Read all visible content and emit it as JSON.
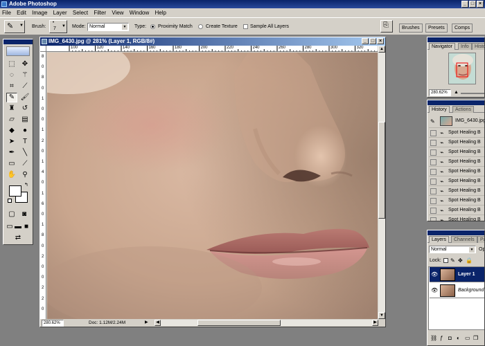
{
  "app": {
    "title": "Adobe Photoshop",
    "window_buttons": [
      "_",
      "□",
      "×"
    ]
  },
  "menubar": {
    "items": [
      "File",
      "Edit",
      "Image",
      "Layer",
      "Select",
      "Filter",
      "View",
      "Window",
      "Help"
    ]
  },
  "options": {
    "brush_label": "Brush:",
    "brush_size": "7",
    "mode_label": "Mode:",
    "mode_value": "Normal",
    "type_label": "Type:",
    "type_options": [
      "Proximity Match",
      "Create Texture"
    ],
    "type_selected": "Proximity Match",
    "sample_all_layers": "Sample All Layers",
    "sample_all_checked": false,
    "palette_well_tabs": [
      "Brushes",
      "Presets",
      "Comps"
    ]
  },
  "document": {
    "title": "IMG_6430.jpg @ 281% (Layer 1, RGB/8#)",
    "ruler_h": [
      "100",
      "120",
      "140",
      "160",
      "180",
      "200",
      "220",
      "240",
      "260",
      "280",
      "300",
      "320",
      "340"
    ],
    "ruler_v": [
      "8",
      "0",
      "8",
      "0",
      "1",
      "0",
      "0",
      "1",
      "2",
      "0",
      "1",
      "4",
      "0",
      "1",
      "6",
      "0",
      "1",
      "8",
      "0",
      "2",
      "0",
      "0",
      "2",
      "2",
      "0"
    ],
    "zoom": "280.62%",
    "doc_info": "Doc: 1.12M/2.24M"
  },
  "navigator": {
    "tabs": [
      "Navigator",
      "Info",
      "Histo"
    ],
    "zoom": "280.62%"
  },
  "history": {
    "tabs": [
      "History",
      "Actions"
    ],
    "snapshot": "IMG_6430.jpg",
    "steps": [
      "Spot Healing B",
      "Spot Healing B",
      "Spot Healing B",
      "Spot Healing B",
      "Spot Healing B",
      "Spot Healing B",
      "Spot Healing B",
      "Spot Healing B",
      "Spot Healing B",
      "Spot Healing B"
    ]
  },
  "layers": {
    "tabs": [
      "Layers",
      "Channels",
      "Pa"
    ],
    "blend_mode": "Normal",
    "opacity_label": "Op",
    "lock_label": "Lock:",
    "items": [
      {
        "name": "Layer 1",
        "selected": true
      },
      {
        "name": "Background",
        "selected": false
      }
    ]
  },
  "colors": {
    "title_bar": "#0a246a",
    "chrome": "#d4d0c8",
    "workspace": "#808080",
    "selection": "#0a246a"
  }
}
